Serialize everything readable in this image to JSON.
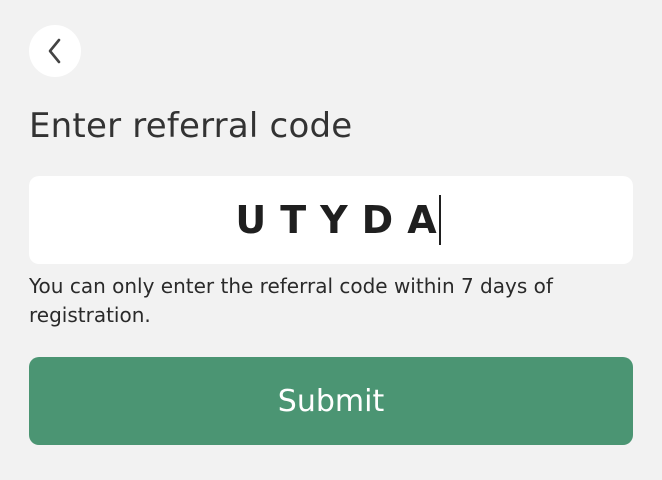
{
  "header": {
    "back_icon": "chevron-left-icon"
  },
  "title": "Enter referral code",
  "referral_input": {
    "value": "UTYDA"
  },
  "hint": "You can only enter the referral code within 7 days of registration.",
  "submit": {
    "label": "Submit"
  },
  "colors": {
    "background": "#f2f2f2",
    "card": "#ffffff",
    "accent": "#4b9573",
    "text": "#333333"
  }
}
